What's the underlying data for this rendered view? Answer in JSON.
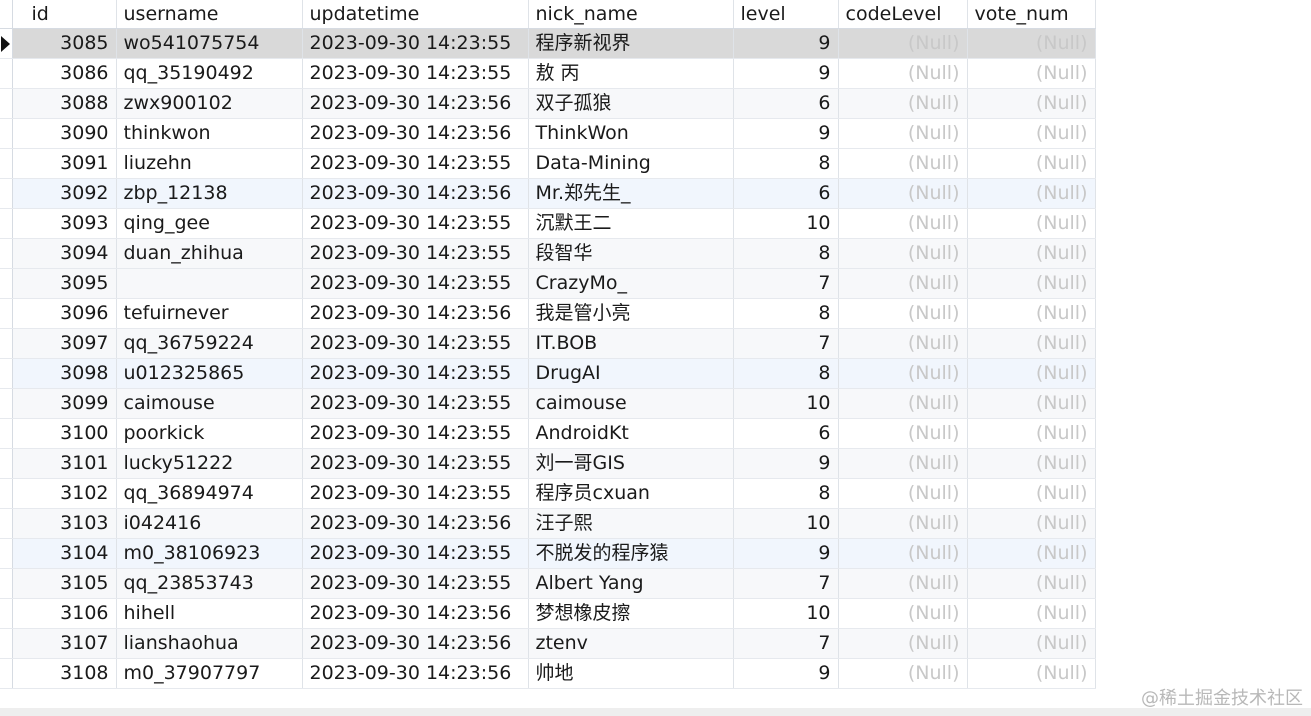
{
  "grid": {
    "columns": [
      "id",
      "username",
      "updatetime",
      "nick_name",
      "level",
      "codeLevel",
      "vote_num"
    ],
    "null_text": "(Null)",
    "selected_row": 0,
    "rows": [
      {
        "id": "3085",
        "username": "wo541075754",
        "updatetime": "2023-09-30 14:23:55",
        "nick_name": "程序新视界",
        "level": "9"
      },
      {
        "id": "3086",
        "username": "qq_35190492",
        "updatetime": "2023-09-30 14:23:55",
        "nick_name": "敖 丙",
        "level": "9"
      },
      {
        "id": "3088",
        "username": "zwx900102",
        "updatetime": "2023-09-30 14:23:56",
        "nick_name": "双子孤狼",
        "level": "6"
      },
      {
        "id": "3090",
        "username": "thinkwon",
        "updatetime": "2023-09-30 14:23:56",
        "nick_name": "ThinkWon",
        "level": "9"
      },
      {
        "id": "3091",
        "username": "liuzehn",
        "updatetime": "2023-09-30 14:23:55",
        "nick_name": "Data-Mining",
        "level": "8"
      },
      {
        "id": "3092",
        "username": "zbp_12138",
        "updatetime": "2023-09-30 14:23:56",
        "nick_name": "Mr.郑先生_",
        "level": "6"
      },
      {
        "id": "3093",
        "username": "qing_gee",
        "updatetime": "2023-09-30 14:23:55",
        "nick_name": "沉默王二",
        "level": "10"
      },
      {
        "id": "3094",
        "username": "duan_zhihua",
        "updatetime": "2023-09-30 14:23:55",
        "nick_name": "段智华",
        "level": "8"
      },
      {
        "id": "3095",
        "username": "",
        "updatetime": "2023-09-30 14:23:55",
        "nick_name": "CrazyMo_",
        "level": "7"
      },
      {
        "id": "3096",
        "username": "tefuirnever",
        "updatetime": "2023-09-30 14:23:56",
        "nick_name": "我是管小亮",
        "level": "8"
      },
      {
        "id": "3097",
        "username": "qq_36759224",
        "updatetime": "2023-09-30 14:23:55",
        "nick_name": "IT.BOB",
        "level": "7"
      },
      {
        "id": "3098",
        "username": "u012325865",
        "updatetime": "2023-09-30 14:23:55",
        "nick_name": "DrugAI",
        "level": "8"
      },
      {
        "id": "3099",
        "username": "caimouse",
        "updatetime": "2023-09-30 14:23:55",
        "nick_name": "caimouse",
        "level": "10"
      },
      {
        "id": "3100",
        "username": "poorkick",
        "updatetime": "2023-09-30 14:23:55",
        "nick_name": "AndroidKt",
        "level": "6"
      },
      {
        "id": "3101",
        "username": "lucky51222",
        "updatetime": "2023-09-30 14:23:55",
        "nick_name": "刘一哥GIS",
        "level": "9"
      },
      {
        "id": "3102",
        "username": "qq_36894974",
        "updatetime": "2023-09-30 14:23:55",
        "nick_name": "程序员cxuan",
        "level": "8"
      },
      {
        "id": "3103",
        "username": "i042416",
        "updatetime": "2023-09-30 14:23:56",
        "nick_name": "汪子熙",
        "level": "10"
      },
      {
        "id": "3104",
        "username": "m0_38106923",
        "updatetime": "2023-09-30 14:23:55",
        "nick_name": "不脱发的程序猿",
        "level": "9"
      },
      {
        "id": "3105",
        "username": "qq_23853743",
        "updatetime": "2023-09-30 14:23:55",
        "nick_name": "Albert Yang",
        "level": "7"
      },
      {
        "id": "3106",
        "username": "hihell",
        "updatetime": "2023-09-30 14:23:56",
        "nick_name": "梦想橡皮擦",
        "level": "10"
      },
      {
        "id": "3107",
        "username": "lianshaohua",
        "updatetime": "2023-09-30 14:23:56",
        "nick_name": "ztenv",
        "level": "7"
      },
      {
        "id": "3108",
        "username": "m0_37907797",
        "updatetime": "2023-09-30 14:23:56",
        "nick_name": "帅地",
        "level": "9"
      }
    ]
  },
  "watermark": "@稀土掘金技术社区"
}
